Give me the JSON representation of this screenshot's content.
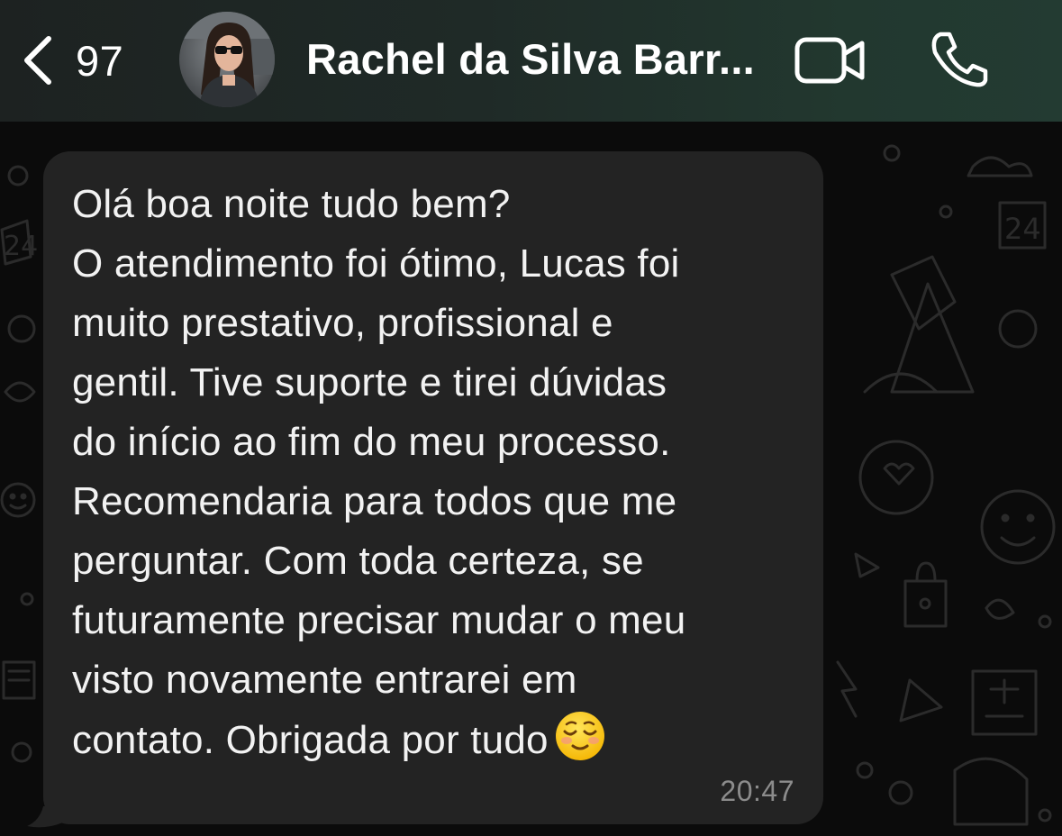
{
  "header": {
    "unread_count": "97",
    "contact_name": "Rachel da Silva Barr...",
    "back_icon": "chevron-left-icon",
    "video_icon": "video-camera-icon",
    "call_icon": "phone-icon"
  },
  "message": {
    "lines": [
      "Olá boa noite tudo bem?",
      "O atendimento foi ótimo, Lucas foi",
      "muito prestativo, profissional e",
      "gentil. Tive suporte e tirei dúvidas",
      "do início ao fim do meu processo.",
      "Recomendaria para todos que me",
      "perguntar. Com toda certeza, se",
      "futuramente precisar mudar o meu",
      "visto novamente entrarei em",
      "contato. Obrigada por tudo"
    ],
    "emoji": "smiling-face-icon",
    "time": "20:47"
  },
  "colors": {
    "header_bg": "#1f2a27",
    "bubble_bg": "#232323",
    "text": "#f2f2f2",
    "timestamp": "#8c8c8c"
  }
}
